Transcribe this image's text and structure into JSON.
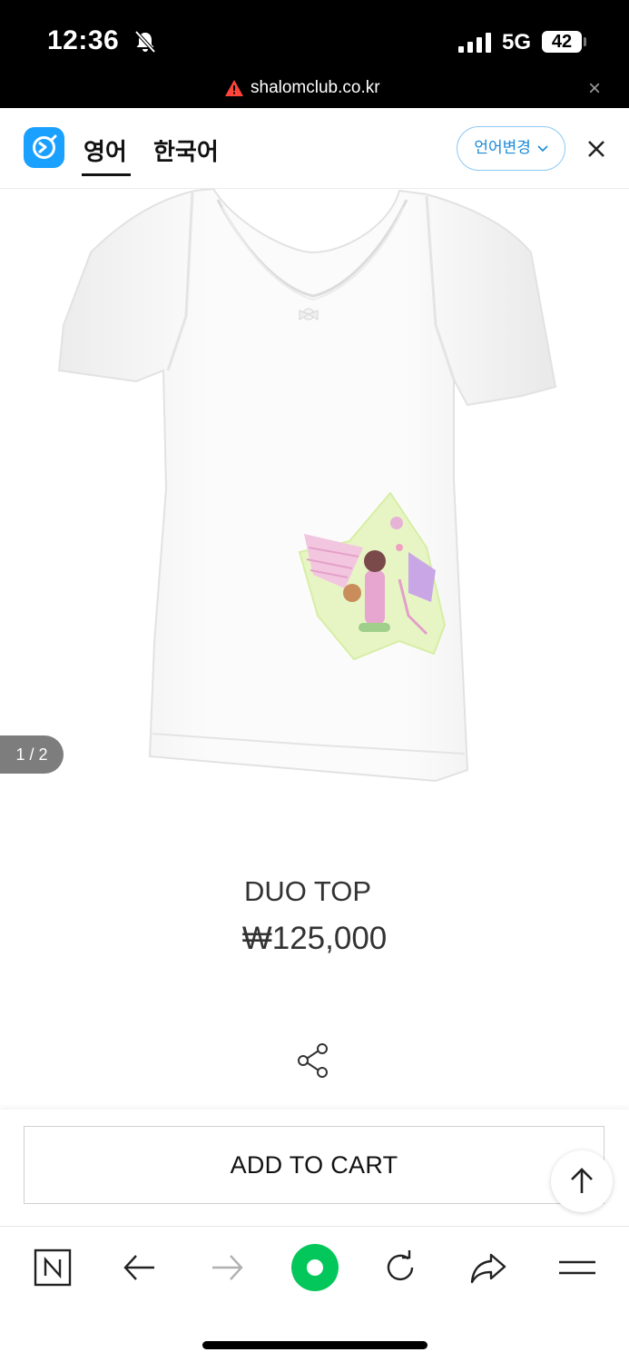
{
  "status_bar": {
    "time": "12:36",
    "network": "5G",
    "battery": "42",
    "url": "shalomclub.co.kr"
  },
  "translate_bar": {
    "tab_english": "영어",
    "tab_korean": "한국어",
    "change_language": "언어변경"
  },
  "product": {
    "pager": "1 / 2",
    "name": "DUO TOP",
    "price": "₩125,000"
  },
  "actions": {
    "add_to_cart": "ADD TO CART"
  },
  "icons": {
    "bell": "bell-slash-icon",
    "share": "share-icon",
    "scroll_top": "arrow-up-icon",
    "browser_home": "naver-n-icon",
    "back": "arrow-left-icon",
    "forward": "arrow-right-icon",
    "green_home": "green-dot-icon",
    "refresh": "refresh-icon",
    "share_out": "share-arrow-icon",
    "menu": "hamburger-icon"
  },
  "colors": {
    "accent_blue": "#1aa0ff",
    "naver_green": "#03c75a"
  }
}
